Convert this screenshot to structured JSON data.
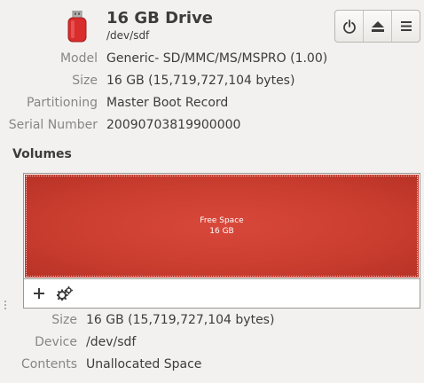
{
  "drive": {
    "title": "16 GB Drive",
    "path": "/dev/sdf",
    "icon": "usb-drive-icon"
  },
  "toolbar": {
    "buttons": [
      {
        "name": "power-off-button",
        "icon": "power-icon"
      },
      {
        "name": "eject-button",
        "icon": "eject-icon"
      },
      {
        "name": "menu-button",
        "icon": "hamburger-menu-icon"
      }
    ]
  },
  "properties": [
    {
      "label": "Model",
      "value": "Generic- SD/MMC/MS/MSPRO (1.00)"
    },
    {
      "label": "Size",
      "value": "16 GB (15,719,727,104 bytes)"
    },
    {
      "label": "Partitioning",
      "value": "Master Boot Record"
    },
    {
      "label": "Serial Number",
      "value": "20090703819900000"
    }
  ],
  "volumes": {
    "heading": "Volumes",
    "block": {
      "line1": "Free Space",
      "line2": "16 GB"
    },
    "toolbar": [
      {
        "name": "create-partition-button",
        "icon": "plus-icon"
      },
      {
        "name": "additional-options-button",
        "icon": "gears-icon"
      }
    ]
  },
  "volume_properties": [
    {
      "label": "Size",
      "value": "16 GB (15,719,727,104 bytes)"
    },
    {
      "label": "Device",
      "value": "/dev/sdf"
    },
    {
      "label": "Contents",
      "value": "Unallocated Space"
    }
  ],
  "colors": {
    "free_space": "#c93d2f",
    "drive_icon": "#d92c2c"
  }
}
